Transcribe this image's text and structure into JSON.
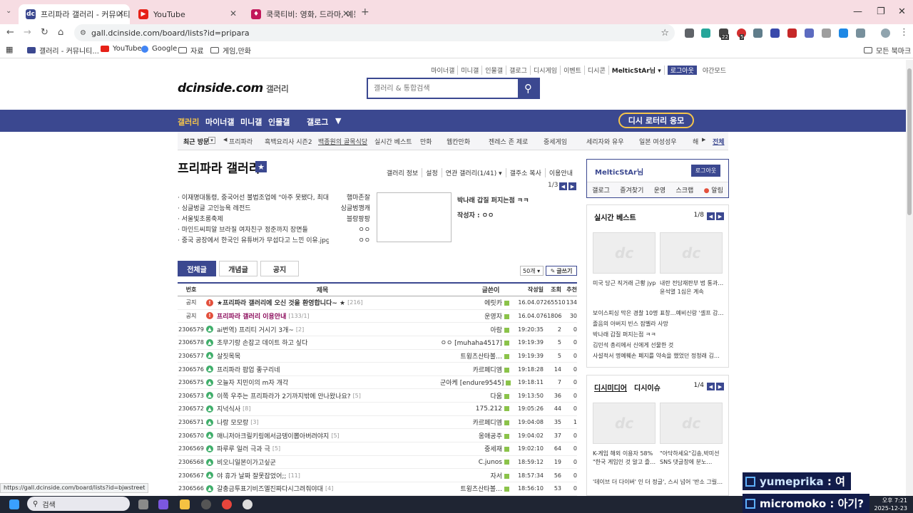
{
  "browser": {
    "tabs": [
      {
        "title": "프리파라 갤러리 - 커뮤니티 포",
        "active": true
      },
      {
        "title": "YouTube",
        "active": false
      },
      {
        "title": "쿡쿡티비: 영화, 드라마, 예능, ",
        "active": false
      }
    ],
    "url": "gall.dcinside.com/board/lists?id=pripara",
    "bookmarks": [
      "갤러리 - 커뮤니티...",
      "YouTube",
      "Google",
      "자료",
      "게임,만화"
    ],
    "all_bookmarks": "모든 북마크",
    "ext_badges": [
      "22",
      "5"
    ]
  },
  "site": {
    "top_menu": [
      "마이너갤",
      "미니갤",
      "인물갤",
      "갤로그",
      "디시게임",
      "이벤트",
      "디시콘",
      "MelticStAr님 ▾",
      "로그아웃",
      "야간모드"
    ],
    "logo": "dcinside.com",
    "logo_sub": "갤러리",
    "search_placeholder": "갤러리 & 통합검색",
    "gnb": [
      "갤러리",
      "마이너갤",
      "미니갤",
      "인물갤",
      "갤로그"
    ],
    "lottery": "디시 로터리 응모",
    "recent_label": "최근 방문",
    "recent": [
      "프리파라",
      "흑백요리사 시즌2",
      "백종원의 골목식당",
      "실시간 베스트",
      "만화",
      "웹칸만화",
      "젠레스 존 제로",
      "중세게임",
      "세리자와 유우",
      "일본 여성성우",
      "해"
    ],
    "recent_all": "전체"
  },
  "gallery": {
    "title": "프리파라 갤러리",
    "menu": [
      "갤러리 정보",
      "설정",
      "연관 갤러리(1/41) ▾",
      "갤주소 복사",
      "이용안내"
    ],
    "pager": "1/3",
    "notices": [
      {
        "title": "· 이재명대통령, 중국어선 불법조업에 \"아주 못됐다, 최대한 …",
        "author": "햄마존잘"
      },
      {
        "title": "· 싱글벙글 고인능욕 레전드",
        "author": "싱글벙깽캐"
      },
      {
        "title": "· 서울빛초롱축제",
        "author": "블랑팡팡"
      },
      {
        "title": "· 마인드씨피알 브라질 여자친구 정준까지 장면들",
        "author": "ㅇㅇ"
      },
      {
        "title": "· 중국 공장에서 한국인 유튜버가 무섭다고 느낀 이유.jpg",
        "author": "ㅇㅇ"
      }
    ],
    "featured_title": "박나래 갑질 퍼지는점 ㅋㅋ",
    "featured_author": "작성자 : ㅇㅇ",
    "tabs": [
      "전체글",
      "개념글",
      "공지"
    ],
    "per_page": "50개 ▾",
    "write": "글쓰기",
    "headers": [
      "번호",
      "제목",
      "글쓴이",
      "작성일",
      "조회",
      "추천"
    ],
    "rows": [
      {
        "no": "공지",
        "icon": "red",
        "title": "★프리파라 갤러리에 오신 것을 환영합니다~ ★",
        "cm": "[216]",
        "writer": "에릿카",
        "date": "16.04.07",
        "views": "265510",
        "rec": "134",
        "bold": true
      },
      {
        "no": "공지",
        "icon": "red",
        "title": "프리파라 갤러리 이용안내",
        "cm": "[133/1]",
        "writer": "운영자",
        "date": "16.04.07",
        "views": "61806",
        "rec": "30",
        "bold": true
      },
      {
        "no": "2306579",
        "icon": "grn",
        "title": "ai번역) 프리티 거시기 3개~",
        "cm": "[2]",
        "writer": "아람",
        "date": "19:20:35",
        "views": "2",
        "rec": "0"
      },
      {
        "no": "2306578",
        "icon": "grn",
        "title": "초무기랑 손잡고 데이트 하고 싶다",
        "cm": "",
        "writer": "ㅇㅇ [muhaha4517]",
        "date": "19:19:39",
        "views": "5",
        "rec": "0"
      },
      {
        "no": "2306577",
        "icon": "grn",
        "title": "살짓목목",
        "cm": "",
        "writer": "트윙츠산타볼…",
        "date": "19:19:39",
        "views": "5",
        "rec": "0"
      },
      {
        "no": "2306576",
        "icon": "grn",
        "title": "프리파라 팝업 좋구리네",
        "cm": "",
        "writer": "카르페디엠",
        "date": "19:18:28",
        "views": "14",
        "rec": "0"
      },
      {
        "no": "2306575",
        "icon": "grn",
        "title": "오늘자 지민이의 m자 개각",
        "cm": "",
        "writer": "군아케 [endure9545]",
        "date": "19:18:11",
        "views": "7",
        "rec": "0"
      },
      {
        "no": "2306573",
        "icon": "grn",
        "title": "이쪽 우주는 프리파라가 2기까지밖에 안나왔나요?",
        "cm": "[5]",
        "writer": "다움",
        "date": "19:13:50",
        "views": "36",
        "rec": "0"
      },
      {
        "no": "2306572",
        "icon": "grn",
        "title": "지넉식사",
        "cm": "[8]",
        "writer": "175.212",
        "date": "19:05:26",
        "views": "44",
        "rec": "0"
      },
      {
        "no": "2306571",
        "icon": "grn",
        "title": "나랑 모모랑",
        "cm": "[3]",
        "writer": "카르페디엠",
        "date": "19:04:08",
        "views": "35",
        "rec": "1"
      },
      {
        "no": "2306570",
        "icon": "grn",
        "title": "매니저아크릴키링에서금뎅이뽑아버려야지",
        "cm": "[5]",
        "writer": "옹애공주",
        "date": "19:04:02",
        "views": "37",
        "rec": "0"
      },
      {
        "no": "2306569",
        "icon": "grn",
        "title": "파루루 일러 극과 극",
        "cm": "[5]",
        "writer": "중세재",
        "date": "19:02:10",
        "views": "64",
        "rec": "0"
      },
      {
        "no": "2306568",
        "icon": "grn",
        "title": "비오니일본이가고싶군",
        "cm": "",
        "writer": "C.junos",
        "date": "18:59:12",
        "views": "19",
        "rec": "0"
      },
      {
        "no": "2306567",
        "icon": "grn",
        "title": "야 휴가 날짜 잘못잡었어;;",
        "cm": "[11]",
        "writer": "자서",
        "date": "18:57:34",
        "views": "56",
        "rec": "0"
      },
      {
        "no": "2306566",
        "icon": "grn",
        "title": "갈충금투표기비즈엘진짜다시그려줘야대",
        "cm": "[4]",
        "writer": "트윙츠산타볼…",
        "date": "18:56:10",
        "views": "53",
        "rec": "0"
      }
    ]
  },
  "right": {
    "username": "MelticStAr님",
    "logout": "로그아웃",
    "usermenu": [
      "갤로그",
      "즐겨찾기",
      "운영",
      "스크랩",
      "알림"
    ],
    "best_title": "실시간 베스트",
    "best_pager": "1/8",
    "best_capts": [
      "미국 당근 직거래 근황 jyp",
      "내란 전담재판부 법 통과…윤석열 1심은 계속"
    ],
    "best_list": [
      "보이스피싱 막은 경찰 10명 표창…예비신랑 '셀프 감…",
      "졸음의 아버지 빈스 잠벨라 사망",
      "박나래 갑질 퍼지는점 ㅋㅋ",
      "김민석 총리에서 신에게 선물한 것",
      "사설적서 명예훼손 폐지를 약속을 했었던 정청래 김…"
    ],
    "media_title": "디시미디어",
    "issue_title": "디시이슈",
    "media_pager": "1/4",
    "media_capts": [
      "K-게임 해외 이용자 58% \"한국 게임인 것 알고 즐…",
      "\"아닥하세요\"김송,박미선 SNS 댓글창에 분노…"
    ],
    "media_line": "'데이브 더 다이버' 인 더 정글', 스시 넘어 '반소 그릴…"
  },
  "status_url": "https://gall.dcinside.com/board/lists?id=bjwstreet",
  "taskbar": {
    "search": "검색",
    "time": "오후 7:21",
    "date": "2025-12-23"
  },
  "chat": [
    {
      "name": "yumeprika",
      "msg": ": 여"
    },
    {
      "name": "micromoko",
      "msg": ": 아기?"
    }
  ]
}
